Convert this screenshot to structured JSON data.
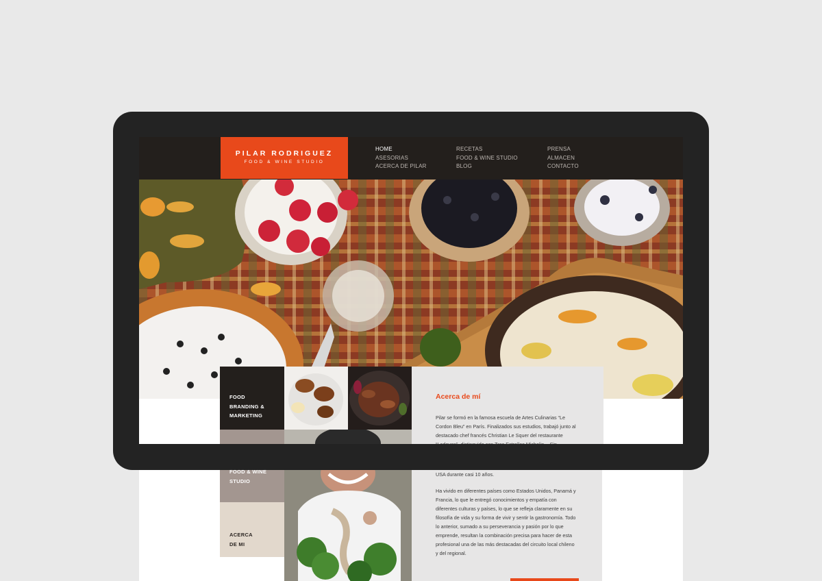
{
  "logo": {
    "name": "PILAR RODRIGUEZ",
    "subtitle": "FOOD & WINE STUDIO"
  },
  "nav": {
    "col1": [
      "HOME",
      "ASESORIAS",
      "ACERCA DE PILAR"
    ],
    "col2": [
      "RECETAS",
      "FOOD & WINE STUDIO",
      "BLOG"
    ],
    "col3": [
      "PRENSA",
      "ALMACEN",
      "CONTACTO"
    ]
  },
  "menu": {
    "branding": "FOOD\nBRANDING &\nMARKETING",
    "studio": "FOOD & WINE\nSTUDIO",
    "about": "ACERCA\nDE MI"
  },
  "about": {
    "title": "Acerca de mí",
    "p1_visible": "Pilar se formó en la famosa escuela de Artes Culinarias “Le Cordon Bleu” en París. Finalizados sus estudios, trabajó junto al destacado chef francés Christian Le Squer del restaurante “Ledoyen”, distinguido con Tres Estrellas Michelin -. Sin",
    "p1_tail": "USA durante casi 10 años.",
    "p2": "Ha vivido en diferentes países como Estados Unidos, Panamá y Francia, lo que le entregó conocimientos y empatía con diferentes culturas y países, lo que se refleja claramente en su filosofía de vida y su forma de vivir y sentir la gastronomía. Todo lo anterior, sumado a su perseverancia y pasión por lo que emprende, resultan la combinación precisa para hacer de esta profesional una de las más destacadas del circuito local chileno y del regional."
  },
  "colors": {
    "accent": "#e8491b",
    "header_bg": "#231f1c",
    "menu_dark": "#231f1c",
    "menu_taupe": "#a39690",
    "menu_beige": "#e2d8cc",
    "device": "#232323",
    "background": "#e9e9e9"
  }
}
